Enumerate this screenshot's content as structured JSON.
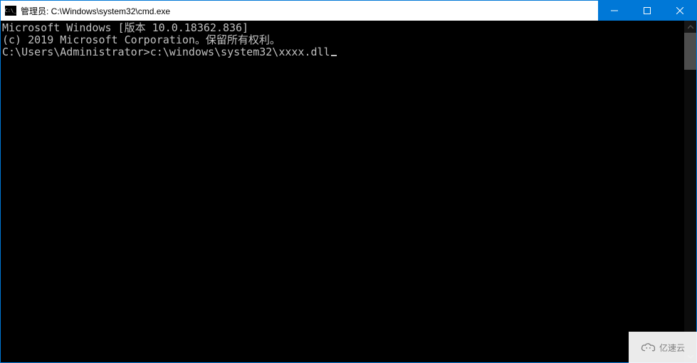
{
  "window": {
    "title": "管理员: C:\\Windows\\system32\\cmd.exe"
  },
  "terminal": {
    "line1": "Microsoft Windows [版本 10.0.18362.836]",
    "line2": "(c) 2019 Microsoft Corporation。保留所有权利。",
    "blank": "",
    "prompt": "C:\\Users\\Administrator>",
    "command": "c:\\windows\\system32\\xxxx.dll"
  },
  "watermark": {
    "text": "亿速云"
  }
}
